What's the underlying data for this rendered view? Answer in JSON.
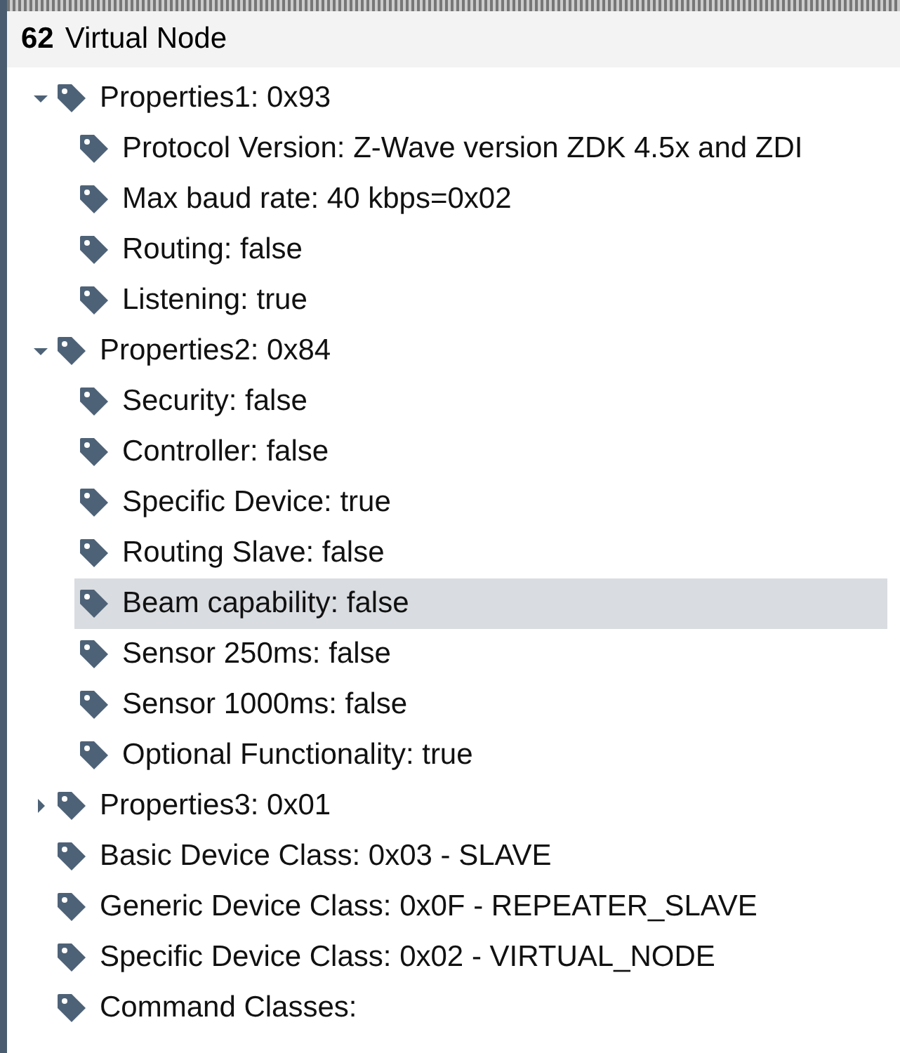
{
  "header": {
    "number": "62",
    "title": "Virtual Node"
  },
  "tree": [
    {
      "label": "Properties1: 0x93",
      "expanded": true,
      "selected": false,
      "children": [
        {
          "label": "Protocol Version: Z-Wave version ZDK 4.5x and ZDI",
          "selected": false
        },
        {
          "label": "Max baud rate: 40 kbps=0x02",
          "selected": false
        },
        {
          "label": "Routing: false",
          "selected": false
        },
        {
          "label": "Listening: true",
          "selected": false
        }
      ]
    },
    {
      "label": "Properties2: 0x84",
      "expanded": true,
      "selected": false,
      "children": [
        {
          "label": "Security: false",
          "selected": false
        },
        {
          "label": "Controller: false",
          "selected": false
        },
        {
          "label": "Specific Device: true",
          "selected": false
        },
        {
          "label": "Routing Slave: false",
          "selected": false
        },
        {
          "label": "Beam capability: false",
          "selected": true
        },
        {
          "label": "Sensor 250ms: false",
          "selected": false
        },
        {
          "label": "Sensor 1000ms: false",
          "selected": false
        },
        {
          "label": "Optional Functionality: true",
          "selected": false
        }
      ]
    },
    {
      "label": "Properties3: 0x01",
      "expanded": false,
      "selected": false
    },
    {
      "label": "Basic Device Class: 0x03 - SLAVE",
      "selected": false
    },
    {
      "label": "Generic Device Class: 0x0F - REPEATER_SLAVE",
      "selected": false
    },
    {
      "label": "Specific Device Class: 0x02 - VIRTUAL_NODE",
      "selected": false
    },
    {
      "label": "Command Classes:",
      "selected": false
    }
  ]
}
